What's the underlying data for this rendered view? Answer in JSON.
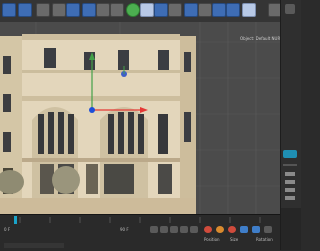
{
  "viewport": {
    "camera_label": "Object: Default NURBS"
  },
  "attributes": {
    "labels": [
      "Position",
      "Size",
      "Rotation"
    ]
  },
  "timeline": {
    "frame_left": "0 F",
    "frame_right": "90 F"
  },
  "colors": {
    "axis_x": "#e53935",
    "axis_y": "#43a047",
    "axis_z": "#1e4fd8",
    "accent": "#3e6db5"
  }
}
